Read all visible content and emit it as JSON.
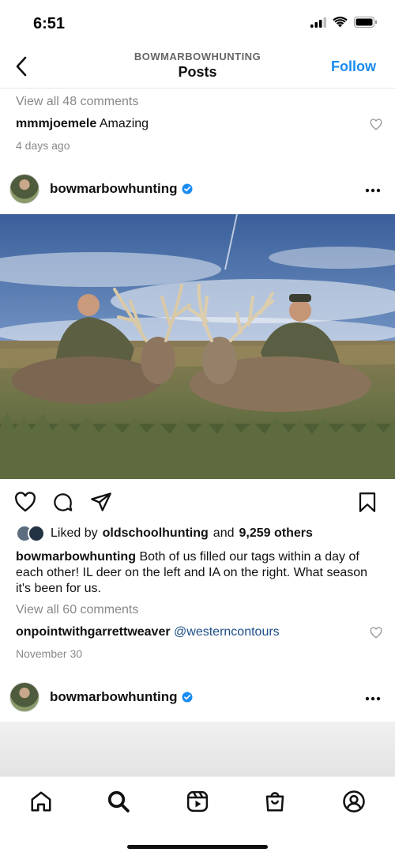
{
  "status": {
    "time": "6:51"
  },
  "header": {
    "account": "BOWMARBOWHUNTING",
    "title": "Posts",
    "follow_label": "Follow"
  },
  "previous_post": {
    "view_all": "View all 48 comments",
    "comment_user": "mmmjoemele",
    "comment_text": "Amazing",
    "time": "4 days ago"
  },
  "post": {
    "username": "bowmarbowhunting",
    "verified": true,
    "liked_by_prefix": "Liked by",
    "liked_by_user": "oldschoolhunting",
    "liked_by_and": "and",
    "liked_by_others": "9,259 others",
    "caption_user": "bowmarbowhunting",
    "caption_text": "Both of us filled our tags within a day of each other! IL deer on the left and IA on the right. What season it's been for us.",
    "view_all": "View all 60 comments",
    "comment_user": "onpointwithgarrettweaver",
    "comment_mention": "@westerncontours",
    "time": "November 30"
  },
  "next_post": {
    "username": "bowmarbowhunting"
  },
  "tabs": [
    "home-icon",
    "search-icon",
    "reels-icon",
    "shop-icon",
    "profile-icon"
  ],
  "colors": {
    "accent": "#1a8cf0",
    "mention": "#1d4e89",
    "verified": "#1a8cf0"
  }
}
